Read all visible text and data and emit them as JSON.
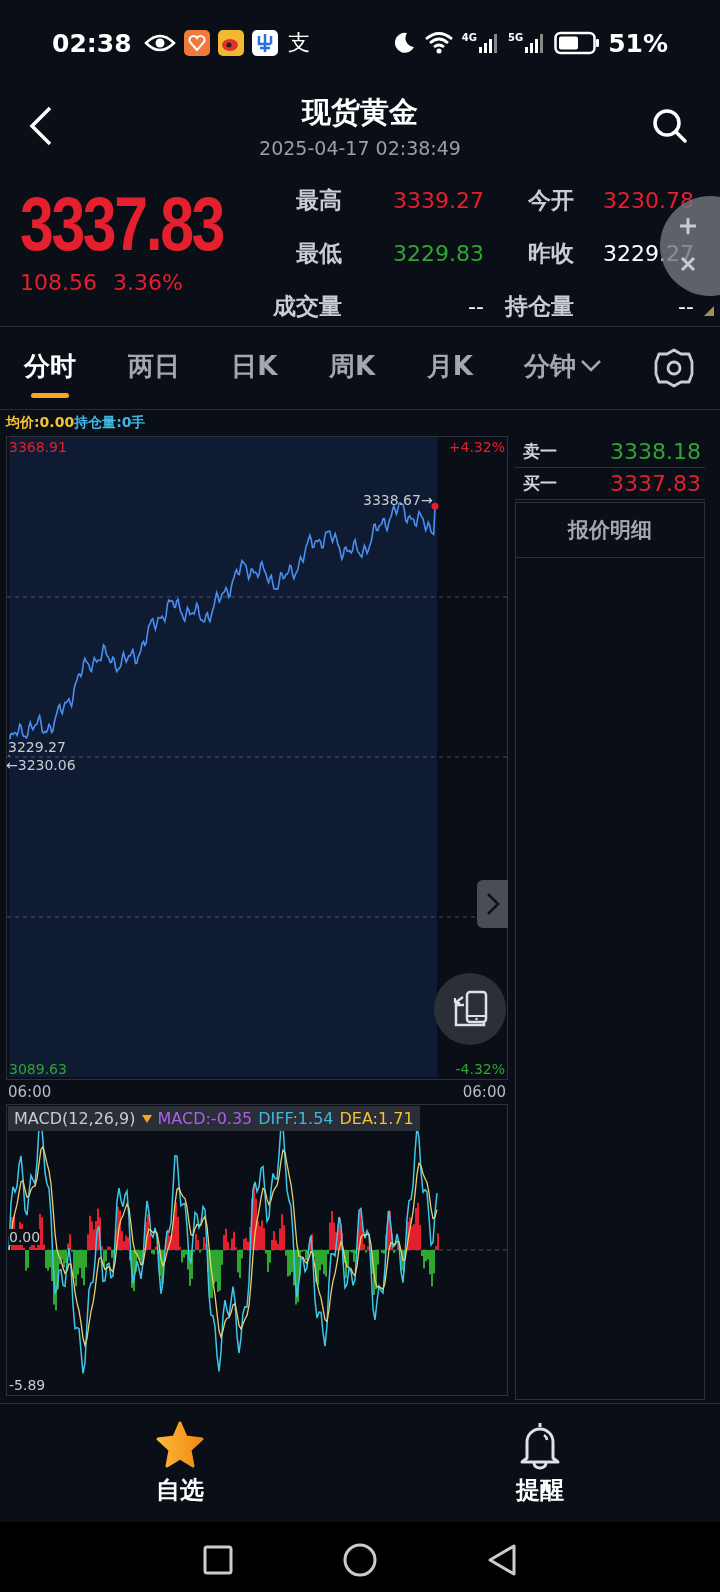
{
  "status_bar": {
    "time": "02:38",
    "glyph": "支",
    "network": [
      "4G",
      "5G"
    ],
    "battery": "51%"
  },
  "header": {
    "title": "现货黄金",
    "timestamp": "2025-04-17 02:38:49"
  },
  "quote": {
    "price": "3337.83",
    "change": "108.56",
    "change_pct": "3.36%",
    "stats": [
      {
        "label": "最高",
        "value": "3339.27",
        "color": "#e5202e"
      },
      {
        "label": "今开",
        "value": "3230.78",
        "color": "#e5202e"
      },
      {
        "label": "最低",
        "value": "3229.83",
        "color": "#2fa62f"
      },
      {
        "label": "昨收",
        "value": "3229.27",
        "color": "#ffffff"
      },
      {
        "label": "成交量",
        "value": "--",
        "color": "#ffffff"
      },
      {
        "label": "持仓量",
        "value": "--",
        "color": "#ffffff"
      }
    ]
  },
  "tabs": [
    {
      "label": "分时",
      "selected": true,
      "kind": "tab"
    },
    {
      "label": "两日",
      "selected": false,
      "kind": "tab"
    },
    {
      "label": "日K",
      "selected": false,
      "kind": "tab"
    },
    {
      "label": "周K",
      "selected": false,
      "kind": "tab"
    },
    {
      "label": "月K",
      "selected": false,
      "kind": "tab"
    },
    {
      "label": "分钟",
      "selected": false,
      "kind": "dropdown"
    }
  ],
  "legend": [
    {
      "text": "均价:0.00",
      "color": "#f2c230"
    },
    {
      "text": "持仓量:0手",
      "color": "#3fb8e0"
    }
  ],
  "price_chart": {
    "high": "3368.91",
    "high_pct": "+4.32%",
    "last": "3338.67→",
    "prev_close": "3229.27",
    "open": "←3230.06",
    "low": "3089.63",
    "low_pct": "-4.32%",
    "x_labels": [
      "06:00",
      "06:00"
    ]
  },
  "order_book": [
    {
      "label": "卖一",
      "value": "3338.18",
      "color": "#2fa62f"
    },
    {
      "label": "买一",
      "value": "3337.83",
      "color": "#e5202e"
    }
  ],
  "detail_title": "报价明细",
  "macd": {
    "title": "MACD(12,26,9)",
    "values": [
      {
        "text": "MACD:-0.35",
        "color": "#b05ee8"
      },
      {
        "text": "DIFF:1.54",
        "color": "#3fb8e0"
      },
      {
        "text": "DEA:1.71",
        "color": "#f2c230"
      }
    ],
    "zero": "0.00",
    "min": "-5.89"
  },
  "bottom_nav": [
    {
      "label": "自选",
      "kind": "star"
    },
    {
      "label": "提醒",
      "kind": "bell"
    }
  ]
}
